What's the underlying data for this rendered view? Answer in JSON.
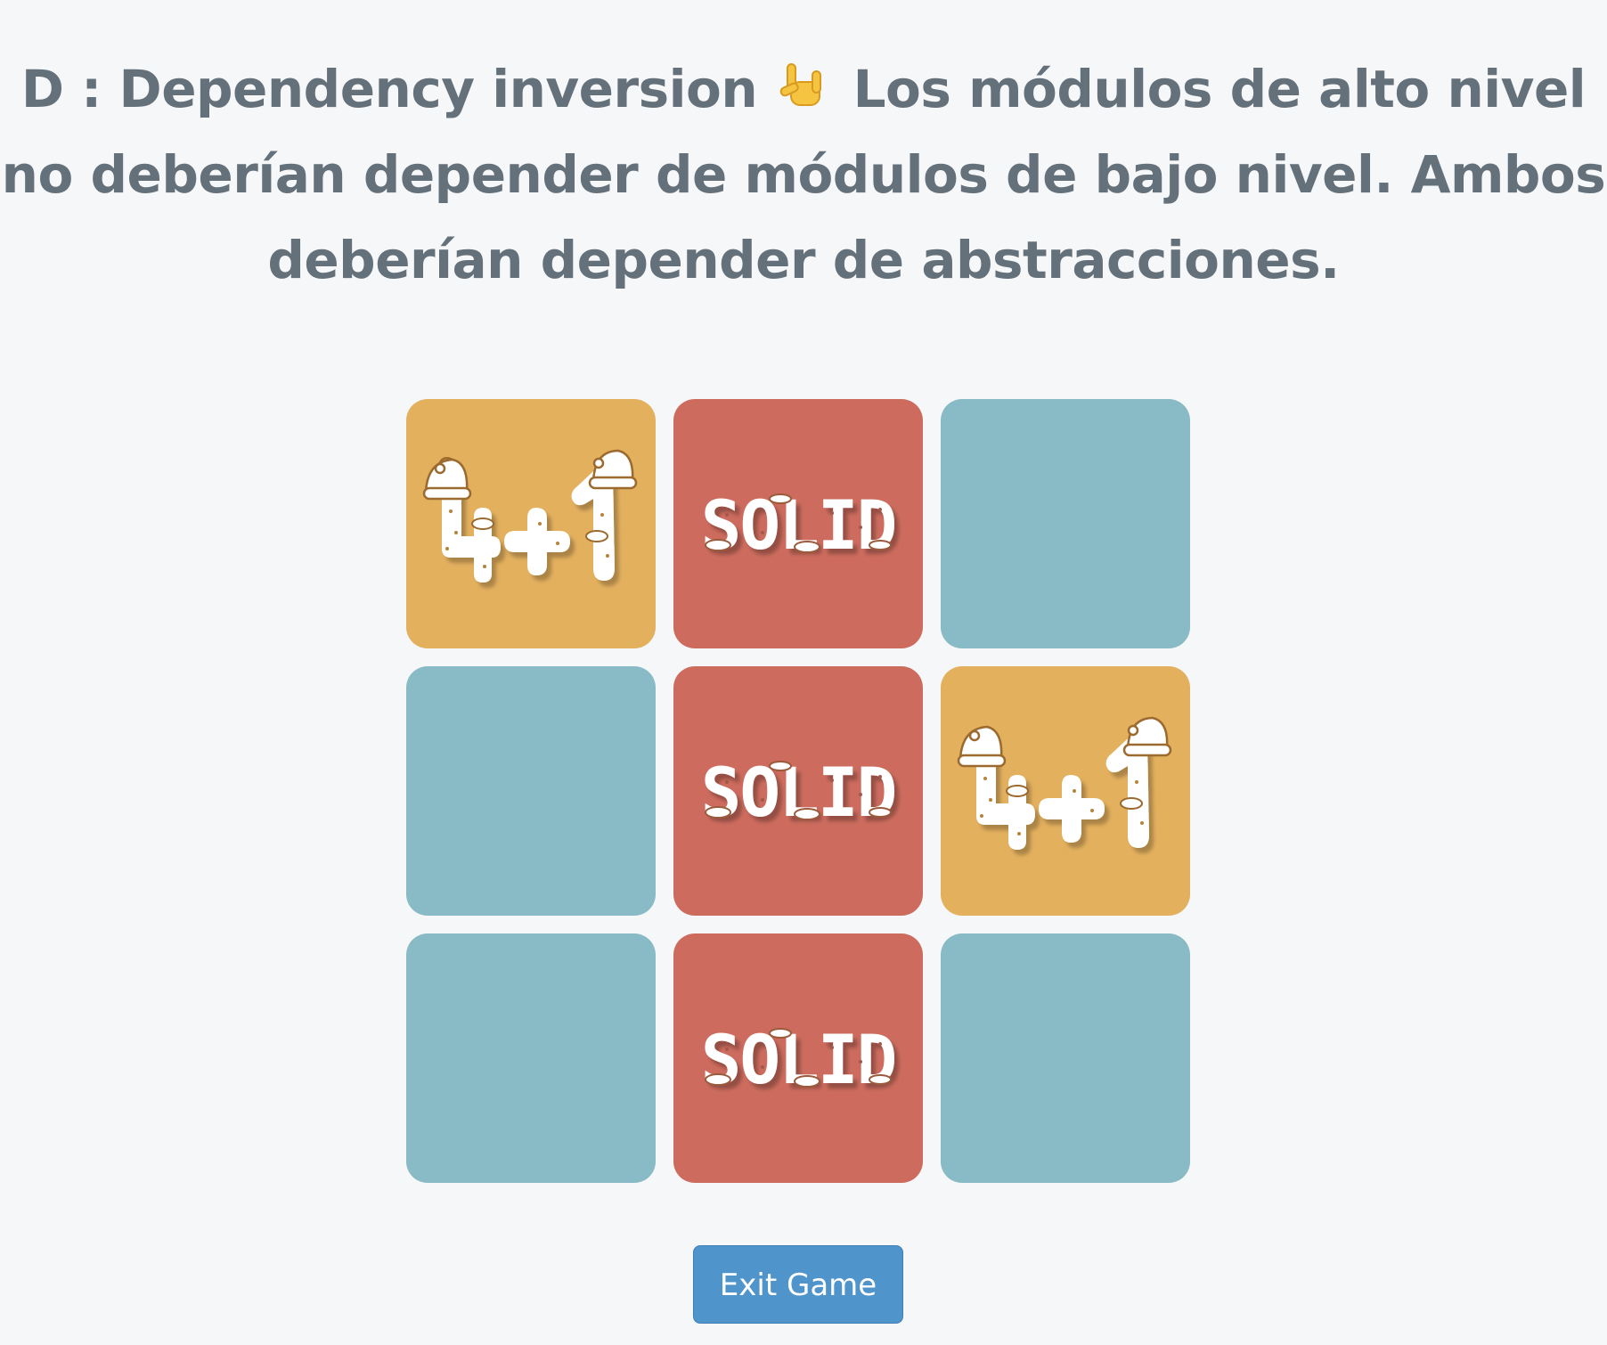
{
  "heading": {
    "before_emoji": "D : Dependency inversion",
    "emoji_name": "love-you-gesture-icon",
    "after_emoji": "Los módulos de alto nivel no deberían depender de módulos de bajo nivel. Ambos deberían depender de abstracciones."
  },
  "colors": {
    "background": "#f6f7f9",
    "heading_text": "#65717a",
    "tile_blue": "#88bbc5",
    "tile_orange": "#e3b05e",
    "tile_red": "#cd6c5e",
    "button": "#4f94cb"
  },
  "board": {
    "tiles": [
      {
        "color": "orange",
        "logo": "4+1",
        "icon": "four-plus-one-santa-logo-icon"
      },
      {
        "color": "red",
        "logo": "SOLID",
        "icon": "solid-logo-icon"
      },
      {
        "color": "blue",
        "logo": "",
        "icon": ""
      },
      {
        "color": "blue",
        "logo": "",
        "icon": ""
      },
      {
        "color": "red",
        "logo": "SOLID",
        "icon": "solid-logo-icon"
      },
      {
        "color": "orange",
        "logo": "4+1",
        "icon": "four-plus-one-santa-logo-icon"
      },
      {
        "color": "blue",
        "logo": "",
        "icon": ""
      },
      {
        "color": "red",
        "logo": "SOLID",
        "icon": "solid-logo-icon"
      },
      {
        "color": "blue",
        "logo": "",
        "icon": ""
      }
    ]
  },
  "exit_button": {
    "label": "Exit Game"
  }
}
